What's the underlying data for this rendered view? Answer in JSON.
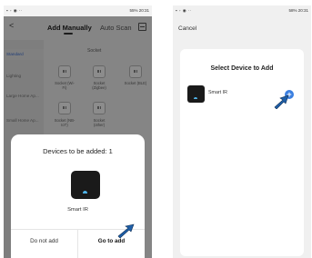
{
  "left_screen": {
    "status": {
      "right": "55% 20:31"
    },
    "nav": {
      "back": "<",
      "tab_manual": "Add Manually",
      "tab_scan": "Auto Scan"
    },
    "sidebar": {
      "items": [
        "Standard",
        "Lighting",
        "Large Home Ap...",
        "Small Home Ap..."
      ]
    },
    "content_title": "Socket",
    "grid": [
      {
        "label": "Socket (Wi-Fi)"
      },
      {
        "label": "Socket (Zigbee)"
      },
      {
        "label": "Socket (BLE)"
      },
      {
        "label": "Socket (NB-IoT)"
      },
      {
        "label": "Socket (other)"
      }
    ],
    "modal": {
      "title": "Devices to be added: 1",
      "device_name": "Smart IR",
      "btn_no": "Do not add",
      "btn_go": "Go to add"
    }
  },
  "right_screen": {
    "status": {
      "right": "58% 20:31"
    },
    "cancel": "Cancel",
    "card_title": "Select Device to Add",
    "device_name": "Smart IR",
    "plus": "+"
  },
  "colors": {
    "accent": "#3b7fe0",
    "arrow": "#1f5fa8",
    "device": "#1a1a1a"
  },
  "icons": [
    "plug-icon",
    "scan-icon",
    "wifi-icon",
    "plus-icon",
    "arrow-pointer-icon"
  ]
}
